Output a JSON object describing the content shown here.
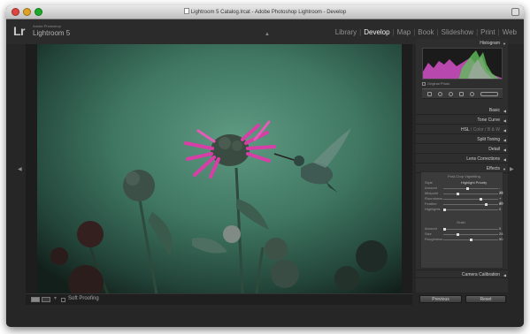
{
  "window": {
    "title": "Lightroom 5 Catalog.lrcat - Adobe Photoshop Lightroom - Develop"
  },
  "identity": {
    "logo": "Lr",
    "subtitle": "Adobe Photoshop",
    "product": "Lightroom 5"
  },
  "modules": [
    {
      "label": "Library",
      "active": false
    },
    {
      "label": "Develop",
      "active": true
    },
    {
      "label": "Map",
      "active": false
    },
    {
      "label": "Book",
      "active": false
    },
    {
      "label": "Slideshow",
      "active": false
    },
    {
      "label": "Print",
      "active": false
    },
    {
      "label": "Web",
      "active": false
    }
  ],
  "right_panel": {
    "histogram_title": "Histogram",
    "original_photo": "Original Photo",
    "sections": {
      "basic": "Basic",
      "tone_curve": "Tone Curve",
      "hsl": "HSL",
      "color": "Color",
      "bw": "B & W",
      "split_toning": "Split Toning",
      "detail": "Detail",
      "lens_corrections": "Lens Corrections",
      "effects": "Effects",
      "camera_calibration": "Camera Calibration"
    },
    "effects": {
      "vignette_heading": "Post-Crop Vignetting",
      "style_label": "Style",
      "style_value": "Highlight Priority",
      "sliders": [
        {
          "label": "Amount",
          "value": "- 15",
          "position": 0.44
        },
        {
          "label": "Midpoint",
          "value": "25",
          "position": 0.25
        },
        {
          "label": "Roundness",
          "value": "+ 40",
          "position": 0.7
        },
        {
          "label": "Feather",
          "value": "80",
          "position": 0.8
        },
        {
          "label": "Highlights",
          "value": "0",
          "position": 0.0
        }
      ],
      "grain_heading": "Grain",
      "grain_sliders": [
        {
          "label": "Amount",
          "value": "0",
          "position": 0.0
        },
        {
          "label": "Size",
          "value": "25",
          "position": 0.25
        },
        {
          "label": "Roughness",
          "value": "50",
          "position": 0.5
        }
      ]
    },
    "previous_button": "Previous",
    "reset_button": "Reset"
  },
  "toolbar": {
    "soft_proofing": "Soft Proofing"
  },
  "colors": {
    "window_bg": "#262626",
    "panel_bg": "#2e2e2e",
    "active_module": "#f0f0f0",
    "inactive_module": "#8f8f8f",
    "histogram_magenta": "#d34fc8",
    "histogram_green": "#5fbf5a"
  },
  "photo": {
    "subject": "hummingbird and bee balm flowers"
  }
}
